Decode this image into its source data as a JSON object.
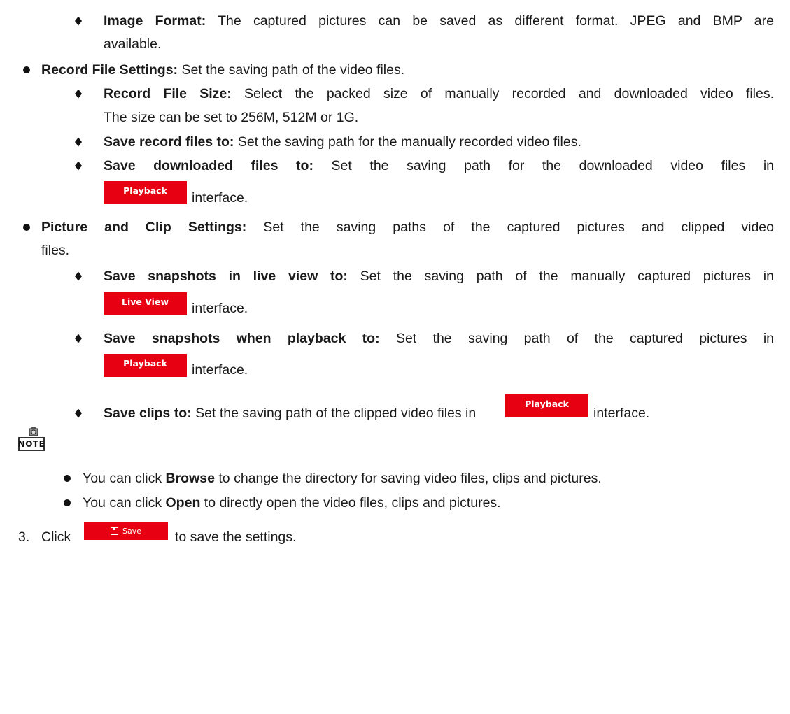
{
  "image_format": {
    "term": "Image Format:",
    "line1": "The captured pictures can be saved as different format. JPEG and BMP are",
    "line2": "available."
  },
  "record_file_settings": {
    "term": "Record File Settings:",
    "text": "Set the saving path of the video files.",
    "record_file_size": {
      "term": "Record File Size:",
      "line1": "Select the packed size of manually recorded and downloaded video files.",
      "line2": "The size can be set to 256M, 512M or 1G."
    },
    "save_record_files": {
      "term": "Save record files to:",
      "text": "Set the saving path for the manually recorded video files."
    },
    "save_downloaded_files": {
      "term": "Save downloaded files to:",
      "line1": "Set the saving path for the downloaded video files in",
      "button": "Playback",
      "after": "interface."
    }
  },
  "picture_clip_settings": {
    "term": "Picture and Clip Settings:",
    "line1": "Set the saving paths of the captured pictures and clipped video",
    "line2": "files.",
    "snapshots_live": {
      "term": "Save snapshots in live view to:",
      "line1": "Set the saving path of the manually captured pictures in",
      "button": "Live View",
      "after": "interface."
    },
    "snapshots_playback": {
      "term": "Save snapshots when playback to:",
      "line1": "Set the saving path of the captured pictures in",
      "button": "Playback",
      "after": "interface."
    },
    "save_clips": {
      "term": "Save clips to:",
      "text": "Set the saving path of the clipped video files in",
      "button": "Playback",
      "after": "interface."
    }
  },
  "note": {
    "label": "NOTE",
    "item1": {
      "pre": "You can click ",
      "bold": "Browse",
      "post": " to change the directory for saving video files, clips and pictures."
    },
    "item2": {
      "pre": "You can click ",
      "bold": "Open",
      "post": " to directly open the video files, clips and pictures."
    }
  },
  "step3": {
    "number": "3.",
    "pre": "Click",
    "button": "Save",
    "post": "to save the settings."
  },
  "colors": {
    "button_red": "#e60012",
    "text": "#1a1a1a"
  },
  "icons": {
    "save_button_icon": "floppy-disk-icon",
    "note_icon": "note-camera-icon"
  }
}
